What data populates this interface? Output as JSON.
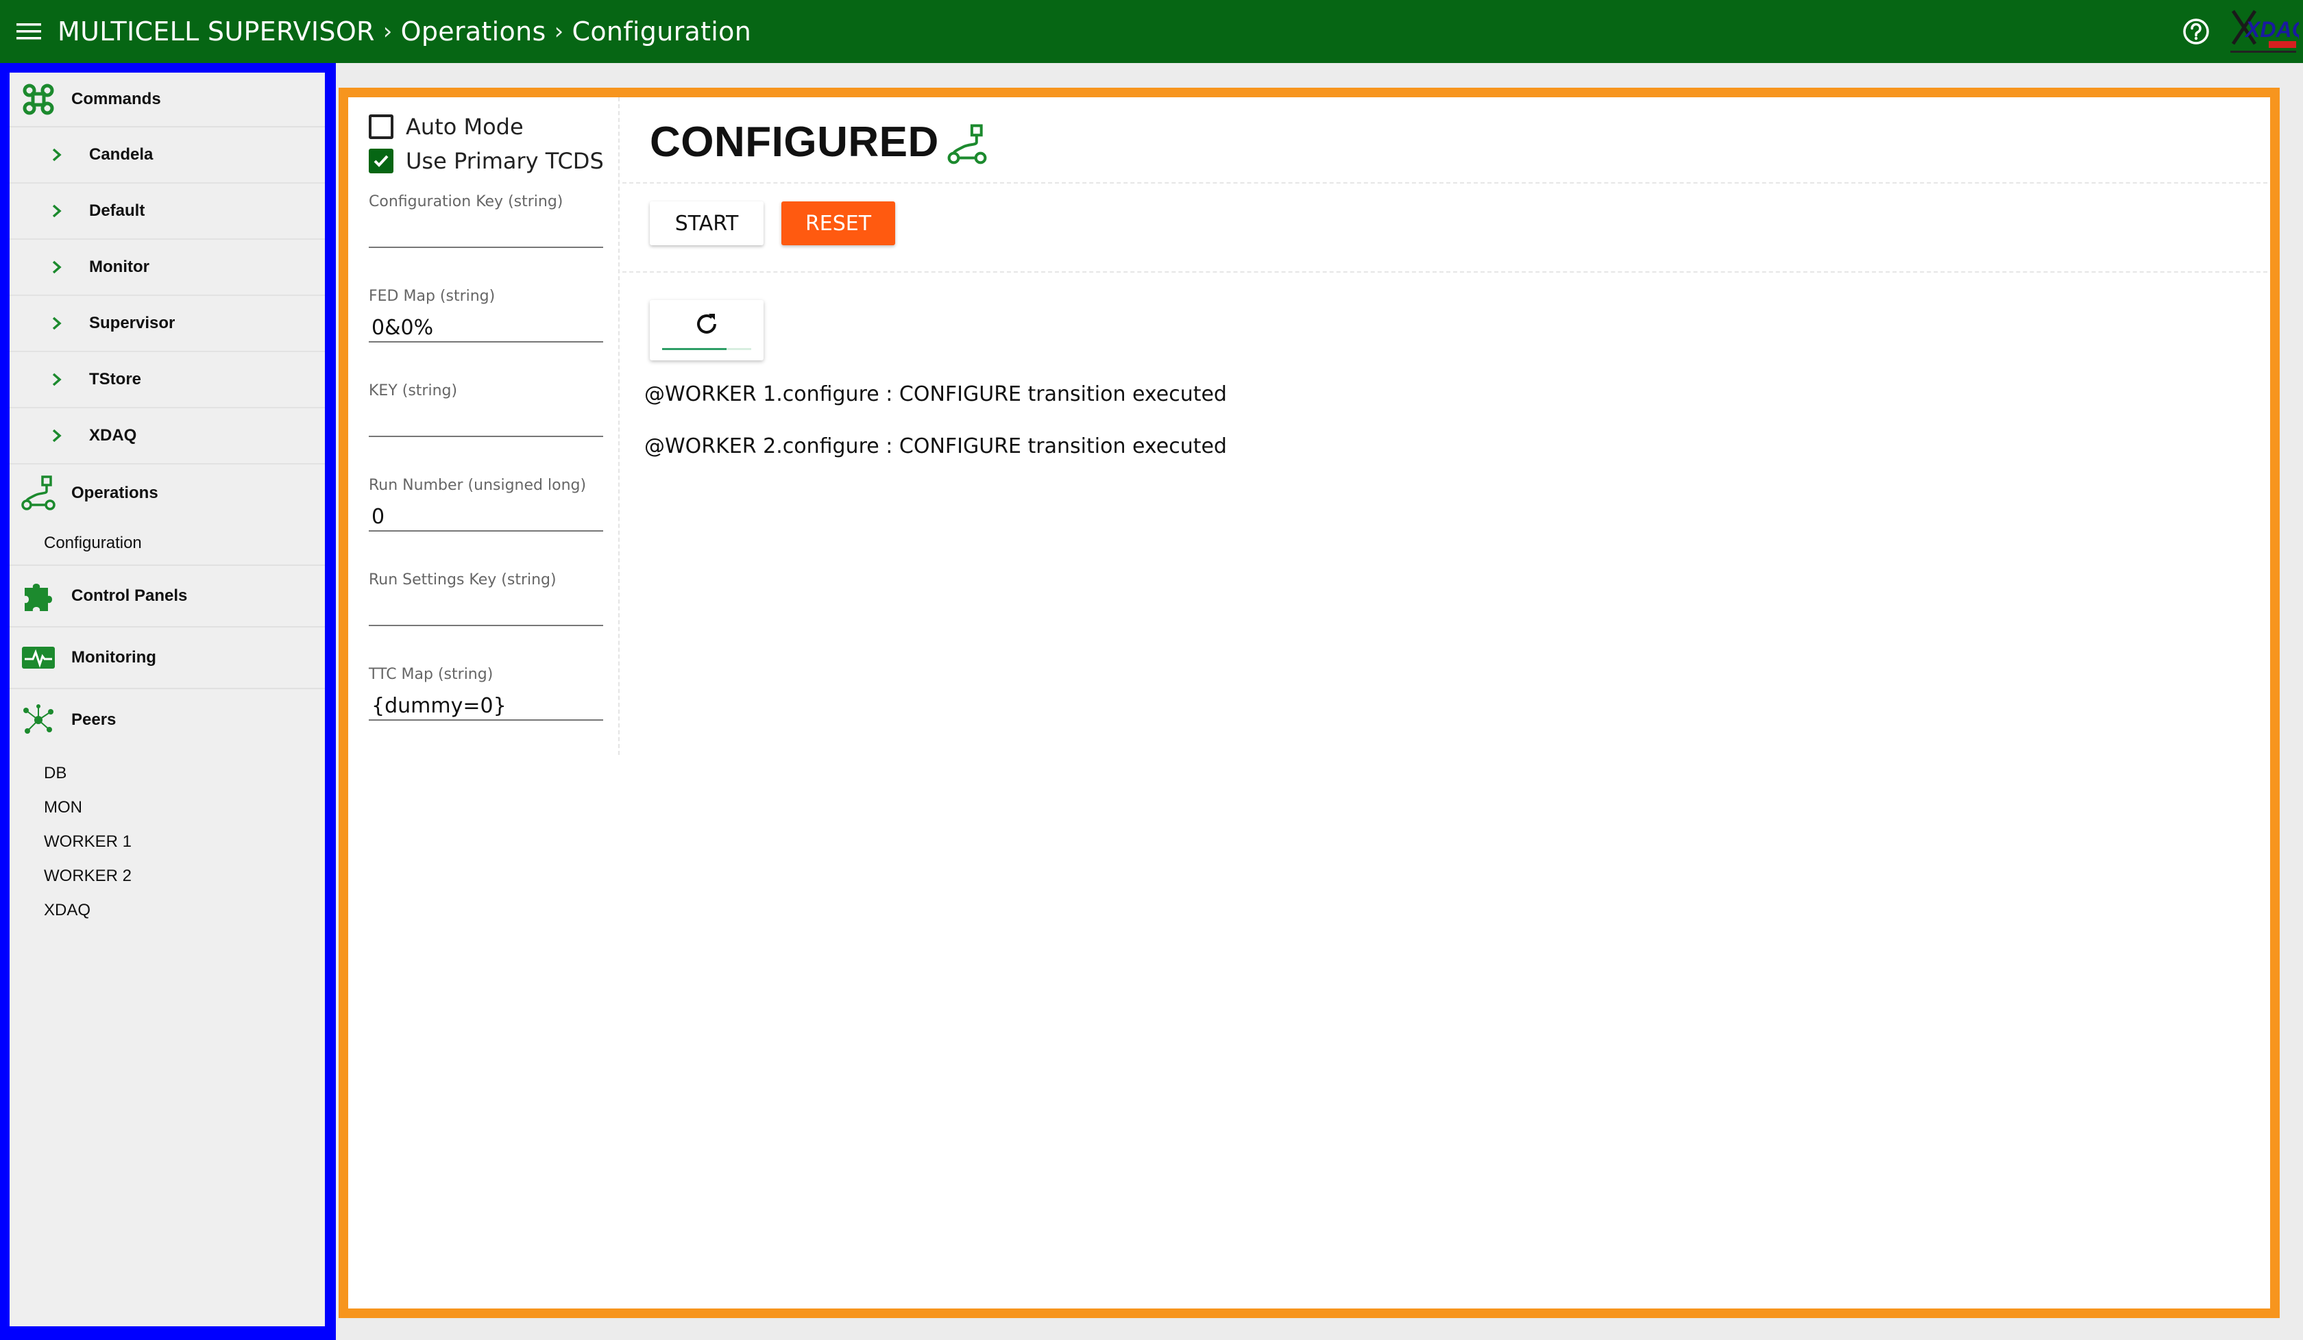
{
  "header": {
    "crumbs": [
      "MULTICELL SUPERVISOR",
      "Operations",
      "Configuration"
    ],
    "logo_text": "XDAQ",
    "colors": {
      "bar": "#066614",
      "accent_frame": "#f7951e",
      "sidebar_frame": "#0000ff"
    }
  },
  "sidebar": {
    "commands_label": "Commands",
    "command_items": [
      "Candela",
      "Default",
      "Monitor",
      "Supervisor",
      "TStore",
      "XDAQ"
    ],
    "operations_label": "Operations",
    "operations_items": [
      "Configuration"
    ],
    "control_panels_label": "Control Panels",
    "monitoring_label": "Monitoring",
    "peers_label": "Peers",
    "peer_items": [
      "DB",
      "MON",
      "WORKER 1",
      "WORKER 2",
      "XDAQ"
    ]
  },
  "form": {
    "auto_mode_label": "Auto Mode",
    "auto_mode_checked": false,
    "use_primary_tcds_label": "Use Primary TCDS",
    "use_primary_tcds_checked": true,
    "fields": [
      {
        "label": "Configuration Key (string)",
        "value": ""
      },
      {
        "label": "FED Map (string)",
        "value": "0&0%"
      },
      {
        "label": "KEY (string)",
        "value": ""
      },
      {
        "label": "Run Number (unsigned long)",
        "value": "0"
      },
      {
        "label": "Run Settings Key (string)",
        "value": ""
      },
      {
        "label": "TTC Map (string)",
        "value": "{dummy=0}"
      }
    ]
  },
  "state": {
    "title": "CONFIGURED",
    "start_label": "START",
    "reset_label": "RESET",
    "reset_color": "#ff5a10"
  },
  "log": [
    "@WORKER 1.configure : CONFIGURE transition executed",
    "@WORKER 2.configure : CONFIGURE transition executed"
  ]
}
